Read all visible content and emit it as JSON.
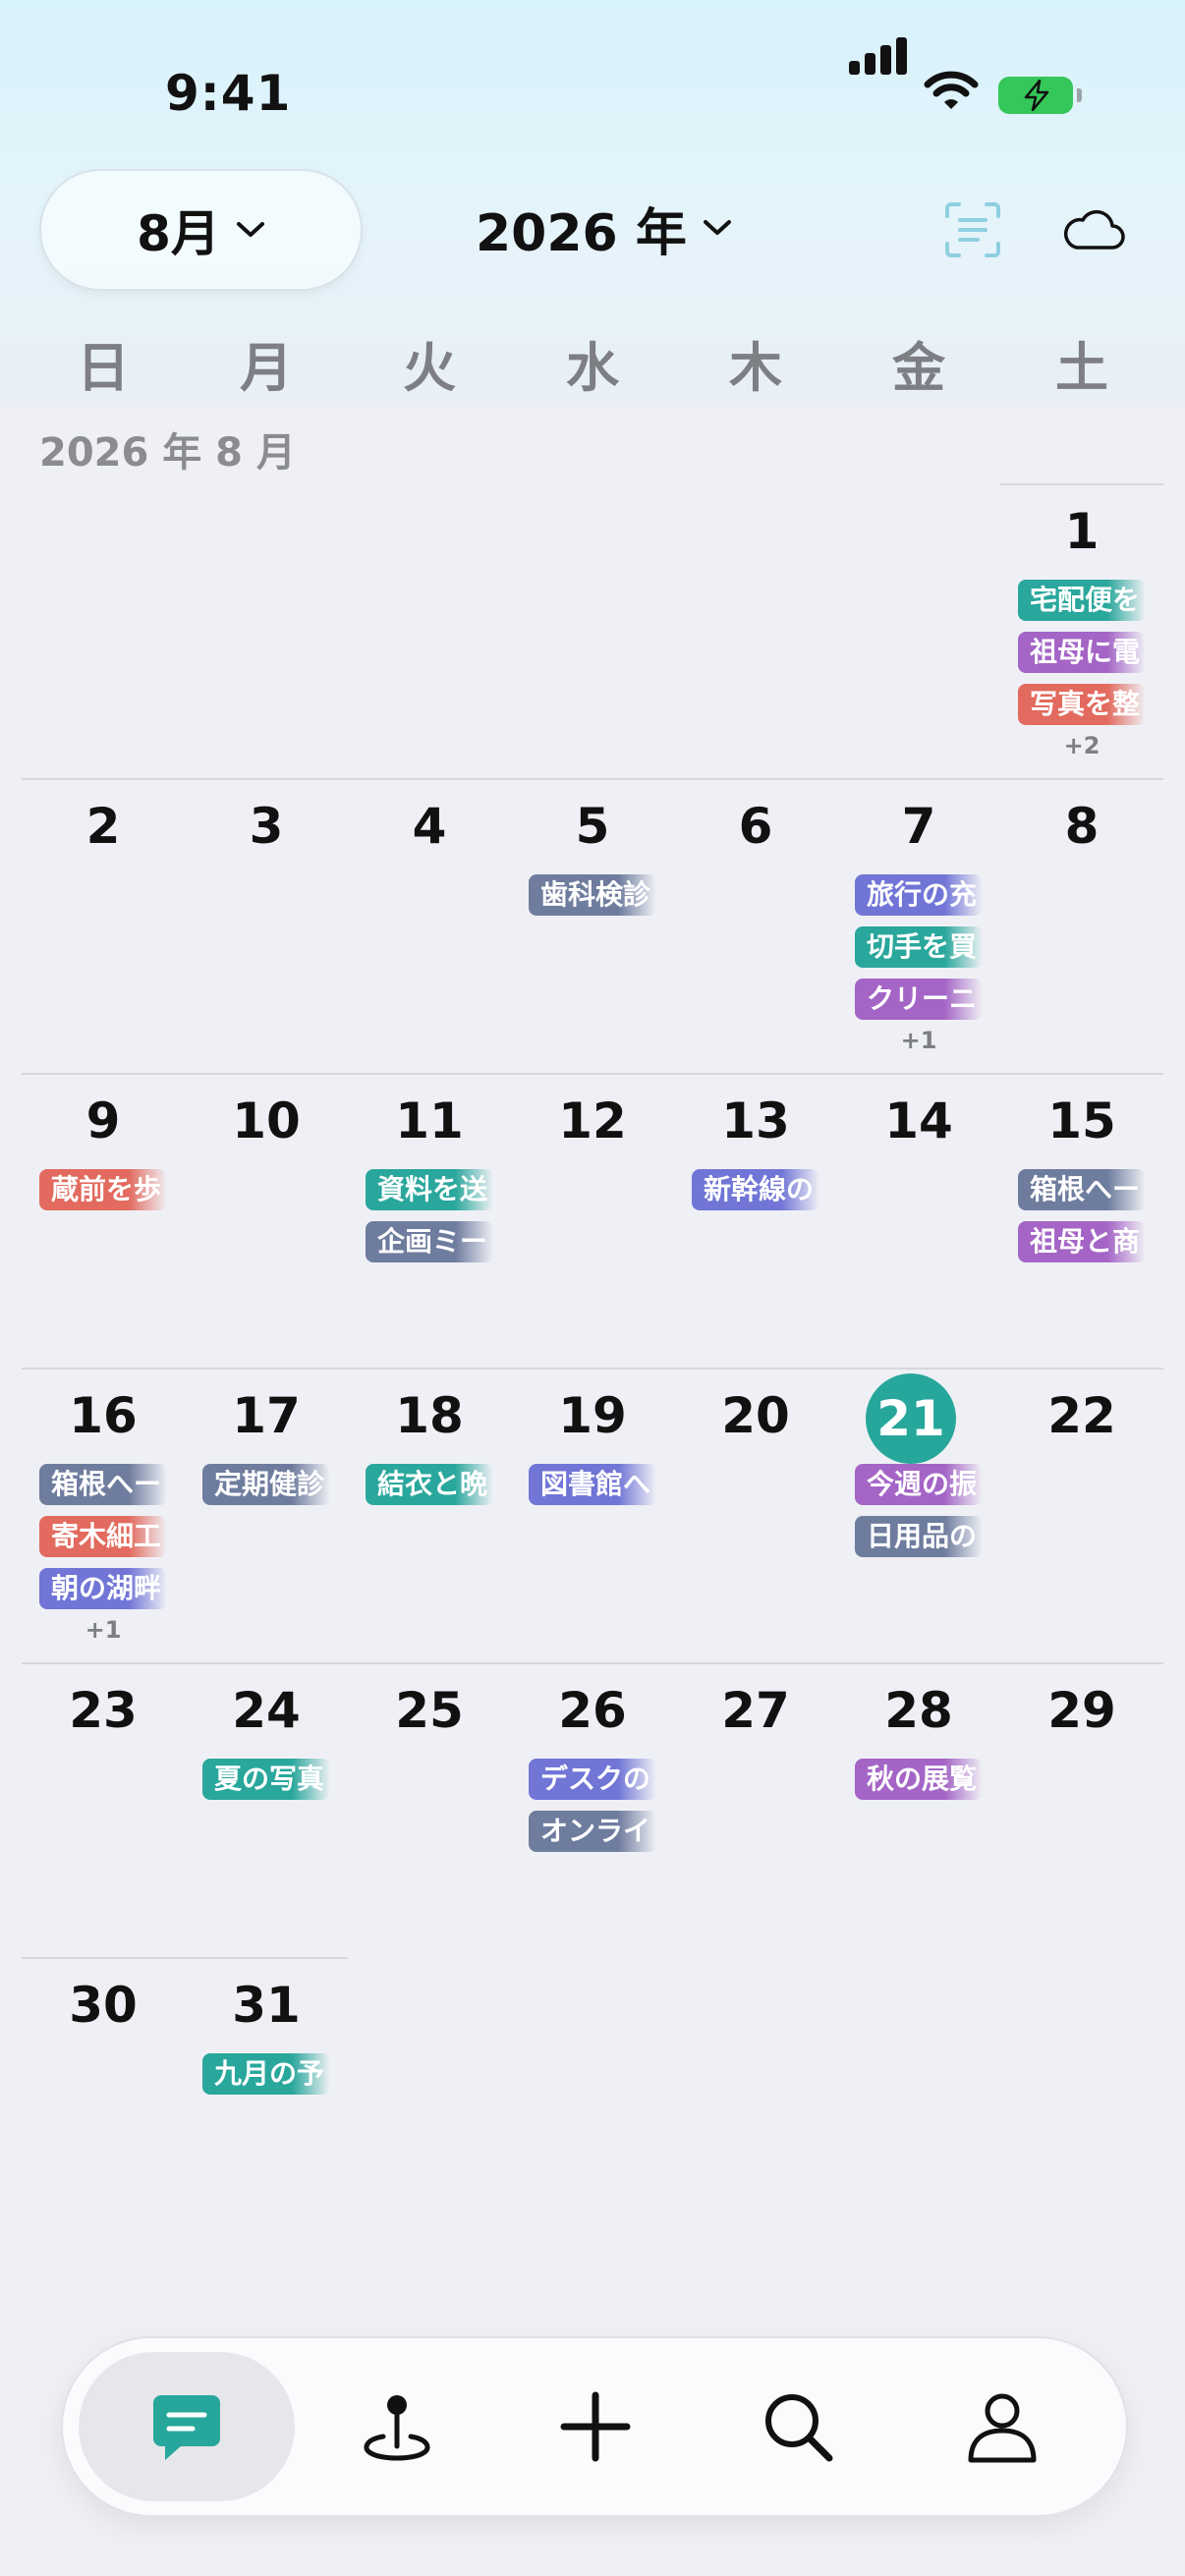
{
  "status_bar": {
    "time": "9:41"
  },
  "header": {
    "month_selector": "8月",
    "year_selector": "2026 年",
    "weekdays": [
      "日",
      "月",
      "火",
      "水",
      "木",
      "金",
      "土"
    ]
  },
  "month_label": "2026 年 8 月",
  "today": 21,
  "colors": {
    "teal": "#2aa79c",
    "purple": "#a465c6",
    "red": "#e26a5e",
    "indigo": "#7075d6",
    "slate": "#6e7c9e",
    "today_circle": "#27a79b"
  },
  "days": [
    {
      "day": 1,
      "events": [
        {
          "label": "宅配便を",
          "color": "teal"
        },
        {
          "label": "祖母に電",
          "color": "purple"
        },
        {
          "label": "写真を整",
          "color": "red"
        }
      ],
      "more": "+2"
    },
    {
      "day": 2,
      "events": []
    },
    {
      "day": 3,
      "events": []
    },
    {
      "day": 4,
      "events": []
    },
    {
      "day": 5,
      "events": [
        {
          "label": "歯科検診",
          "color": "slate"
        }
      ]
    },
    {
      "day": 6,
      "events": []
    },
    {
      "day": 7,
      "events": [
        {
          "label": "旅行の充",
          "color": "indigo"
        },
        {
          "label": "切手を買",
          "color": "teal"
        },
        {
          "label": "クリーニ",
          "color": "purple"
        }
      ],
      "more": "+1"
    },
    {
      "day": 8,
      "events": []
    },
    {
      "day": 9,
      "events": [
        {
          "label": "蔵前を歩",
          "color": "red"
        }
      ]
    },
    {
      "day": 10,
      "events": []
    },
    {
      "day": 11,
      "events": [
        {
          "label": "資料を送",
          "color": "teal"
        },
        {
          "label": "企画ミー",
          "color": "slate"
        }
      ]
    },
    {
      "day": 12,
      "events": []
    },
    {
      "day": 13,
      "events": [
        {
          "label": "新幹線の",
          "color": "indigo"
        }
      ]
    },
    {
      "day": 14,
      "events": []
    },
    {
      "day": 15,
      "events": [
        {
          "label": "箱根へー",
          "color": "slate"
        },
        {
          "label": "祖母と商",
          "color": "purple"
        }
      ]
    },
    {
      "day": 16,
      "events": [
        {
          "label": "箱根へー",
          "color": "slate"
        },
        {
          "label": "寄木細工",
          "color": "red"
        },
        {
          "label": "朝の湖畔",
          "color": "indigo"
        }
      ],
      "more": "+1"
    },
    {
      "day": 17,
      "events": [
        {
          "label": "定期健診",
          "color": "slate"
        }
      ]
    },
    {
      "day": 18,
      "events": [
        {
          "label": "結衣と晩",
          "color": "teal"
        }
      ]
    },
    {
      "day": 19,
      "events": [
        {
          "label": "図書館へ",
          "color": "indigo"
        }
      ]
    },
    {
      "day": 20,
      "events": []
    },
    {
      "day": 21,
      "events": [
        {
          "label": "今週の振",
          "color": "purple"
        },
        {
          "label": "日用品の",
          "color": "slate"
        }
      ]
    },
    {
      "day": 22,
      "events": []
    },
    {
      "day": 23,
      "events": []
    },
    {
      "day": 24,
      "events": [
        {
          "label": "夏の写真",
          "color": "teal"
        }
      ]
    },
    {
      "day": 25,
      "events": []
    },
    {
      "day": 26,
      "events": [
        {
          "label": "デスクの",
          "color": "indigo"
        },
        {
          "label": "オンライ",
          "color": "slate"
        }
      ]
    },
    {
      "day": 27,
      "events": []
    },
    {
      "day": 28,
      "events": [
        {
          "label": "秋の展覧",
          "color": "purple"
        }
      ]
    },
    {
      "day": 29,
      "events": []
    },
    {
      "day": 30,
      "events": []
    },
    {
      "day": 31,
      "events": [
        {
          "label": "九月の予",
          "color": "teal"
        }
      ]
    }
  ],
  "tab_bar": {
    "active": "chat",
    "tabs": [
      {
        "id": "chat",
        "icon": "chat-bubble-icon"
      },
      {
        "id": "map",
        "icon": "map-pin-icon"
      },
      {
        "id": "add",
        "icon": "plus-icon"
      },
      {
        "id": "search",
        "icon": "search-icon"
      },
      {
        "id": "profile",
        "icon": "person-icon"
      }
    ]
  }
}
